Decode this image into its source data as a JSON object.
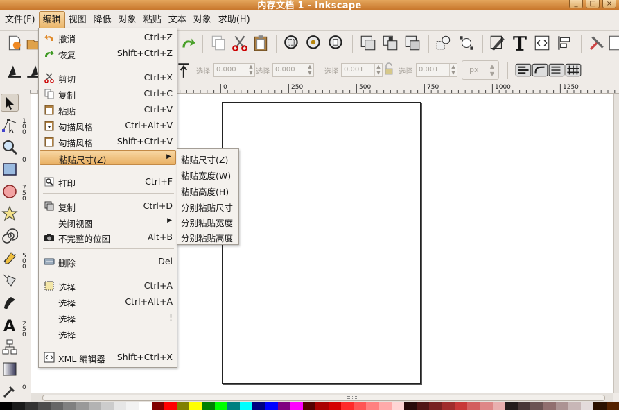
{
  "window": {
    "title": "内存文档 1 - Inkscape",
    "controls": [
      "_",
      "□",
      "×"
    ]
  },
  "menubar": [
    {
      "label": "文件(F)",
      "active": false
    },
    {
      "label": "编辑",
      "active": true
    },
    {
      "label": "视图",
      "active": false
    },
    {
      "label": "降低",
      "active": false
    },
    {
      "label": "对象",
      "active": false
    },
    {
      "label": "粘贴",
      "active": false
    },
    {
      "label": "文本",
      "active": false
    },
    {
      "label": "对象",
      "active": false
    },
    {
      "label": "求助(H)",
      "active": false
    }
  ],
  "edit_menu": {
    "items": [
      {
        "label": "撤消",
        "shortcut": "Ctrl+Z",
        "icon": "undo-icon"
      },
      {
        "label": "恢复",
        "shortcut": "Shift+Ctrl+Z",
        "icon": "redo-icon"
      },
      {
        "label": "剪切",
        "shortcut": "Ctrl+X",
        "icon": "cut-icon"
      },
      {
        "label": "复制",
        "shortcut": "Ctrl+C",
        "icon": "copy-icon"
      },
      {
        "label": "粘贴",
        "shortcut": "Ctrl+V",
        "icon": "paste-icon"
      },
      {
        "label": "勾描风格",
        "shortcut": "Ctrl+Alt+V",
        "icon": "paste-style-icon"
      },
      {
        "label": "勾描风格",
        "shortcut": "Shift+Ctrl+V",
        "icon": "paste-inplace-icon"
      },
      {
        "label": "粘贴尺寸(Z)",
        "shortcut": "",
        "icon": "",
        "submenu": true
      },
      {
        "label": "打印",
        "shortcut": "Ctrl+F",
        "icon": "print-preview-icon"
      },
      {
        "label": "复制",
        "shortcut": "Ctrl+D",
        "icon": "duplicate-icon"
      },
      {
        "label": "关闭视图",
        "shortcut": "",
        "icon": "",
        "submenu": true
      },
      {
        "label": "不完整的位图",
        "shortcut": "Alt+B",
        "icon": "camera-icon"
      },
      {
        "label": "删除",
        "shortcut": "Del",
        "icon": "delete-icon"
      },
      {
        "label": "选择",
        "shortcut": "Ctrl+A",
        "icon": "select-all-icon"
      },
      {
        "label": "选择",
        "shortcut": "Ctrl+Alt+A",
        "icon": ""
      },
      {
        "label": "选择",
        "shortcut": "!",
        "icon": ""
      },
      {
        "label": "选择",
        "shortcut": "",
        "icon": ""
      },
      {
        "label": "XML 编辑器",
        "shortcut": "Shift+Ctrl+X",
        "icon": "xml-editor-icon"
      }
    ]
  },
  "paste_size_submenu": [
    "粘贴尺寸(Z)",
    "粘贴宽度(W)",
    "粘贴高度(H)",
    "分别粘贴尺寸",
    "分别粘贴宽度",
    "分别粘贴高度"
  ],
  "controls_bar": {
    "fields": [
      {
        "label": "选择",
        "value": "0.000"
      },
      {
        "label": "选择",
        "value": "0.000"
      },
      {
        "label": "选择",
        "value": "0.001"
      },
      {
        "label": "选择",
        "value": "0.001"
      }
    ],
    "unit": "px"
  },
  "rulers": {
    "horizontal": [
      "0",
      "250",
      "500",
      "750",
      "1000",
      "1250"
    ],
    "vertical": [
      "100",
      "0",
      "750",
      "500",
      "250",
      "0"
    ]
  },
  "palette": [
    "#000000",
    "#1a1a1a",
    "#333333",
    "#4d4d4d",
    "#666666",
    "#808080",
    "#999999",
    "#b3b3b3",
    "#cccccc",
    "#e6e6e6",
    "#f2f2f2",
    "#ffffff",
    "#800000",
    "#ff0000",
    "#808000",
    "#ffff00",
    "#008000",
    "#00ff00",
    "#008080",
    "#00ffff",
    "#000080",
    "#0000ff",
    "#800080",
    "#ff00ff",
    "#550000",
    "#aa0000",
    "#d40000",
    "#ff2a2a",
    "#ff5555",
    "#ff8080",
    "#ffaaaa",
    "#ffd5d5",
    "#280b0b",
    "#501616",
    "#782121",
    "#a02c2c",
    "#c83737",
    "#d35f5f",
    "#de8787",
    "#e9afaf",
    "#241c1c",
    "#483737",
    "#6c5353",
    "#916f6f",
    "#ac9393",
    "#c8b7b7",
    "#e3dbdb",
    "#2b1100",
    "#552200"
  ]
}
